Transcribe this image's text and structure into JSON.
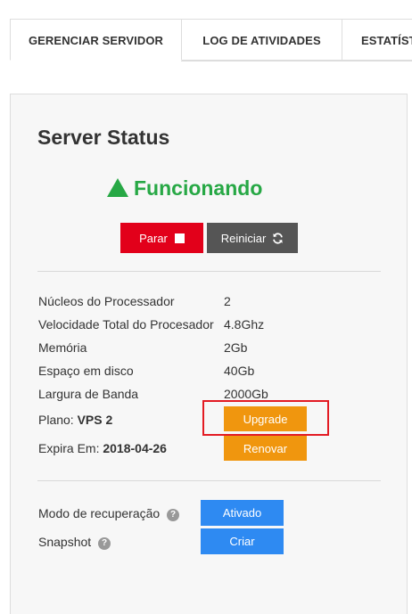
{
  "tabs": [
    {
      "label": "GERENCIAR SERVIDOR",
      "active": true
    },
    {
      "label": "LOG DE ATIVIDADES",
      "active": false
    },
    {
      "label": "ESTATÍSTICAS",
      "active": false
    }
  ],
  "panel": {
    "title": "Server Status",
    "status": "Funcionando",
    "buttons": {
      "stop": "Parar",
      "restart": "Reiniciar"
    },
    "specs": [
      {
        "label": "Núcleos do Processador",
        "value": "2"
      },
      {
        "label": "Velocidade Total do Procesador",
        "value": "4.8Ghz"
      },
      {
        "label": "Memória",
        "value": "2Gb"
      },
      {
        "label": "Espaço em disco",
        "value": "40Gb"
      },
      {
        "label": "Largura de Banda",
        "value": "2000Gb"
      }
    ],
    "plan": {
      "label": "Plano:",
      "value": "VPS 2",
      "button": "Upgrade"
    },
    "expires": {
      "label": "Expira Em:",
      "value": "2018-04-26",
      "button": "Renovar"
    },
    "recovery": {
      "label": "Modo de recuperação",
      "button": "Ativado"
    },
    "snapshot": {
      "label": "Snapshot",
      "button": "Criar"
    }
  },
  "colors": {
    "status_green": "#27a845",
    "stop_red": "#e2001a",
    "restart_gray": "#555555",
    "orange": "#f0960e",
    "blue": "#2e8af2",
    "highlight_red": "#e31b23"
  },
  "icons": {
    "status": "triangle-up-icon",
    "stop": "stop-square-icon",
    "restart": "refresh-icon",
    "help": "question-circle-icon"
  }
}
